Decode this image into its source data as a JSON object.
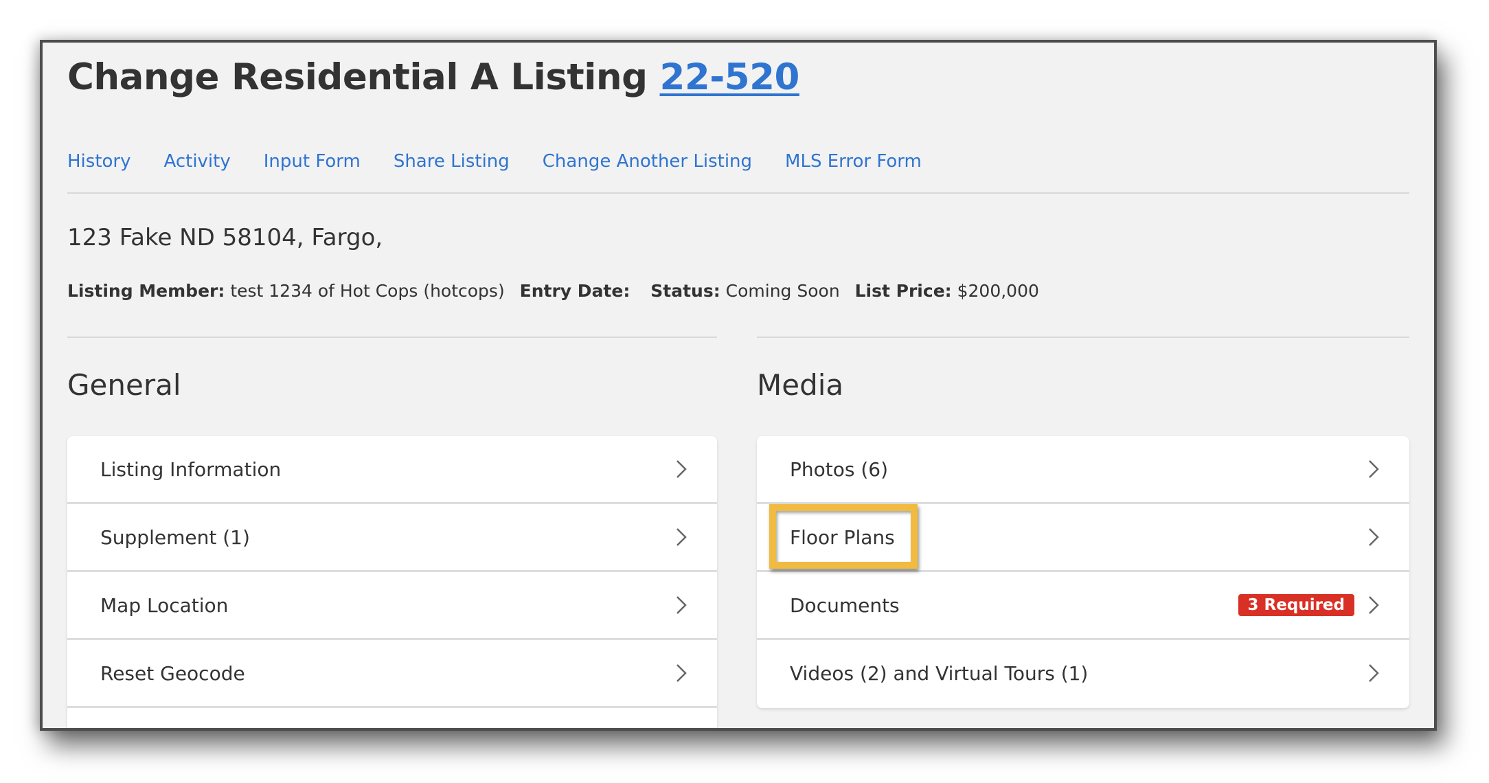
{
  "header": {
    "title": "Change Residential A Listing",
    "listing_id": "22-520"
  },
  "nav_links": [
    {
      "label": "History"
    },
    {
      "label": "Activity"
    },
    {
      "label": "Input Form"
    },
    {
      "label": "Share Listing"
    },
    {
      "label": "Change Another Listing"
    },
    {
      "label": "MLS Error Form"
    }
  ],
  "listing": {
    "address": "123 Fake ND 58104, Fargo,",
    "member_label": "Listing Member:",
    "member_value": "test 1234 of Hot Cops (hotcops)",
    "entry_date_label": "Entry Date:",
    "entry_date_value": "",
    "status_label": "Status:",
    "status_value": "Coming Soon",
    "price_label": "List Price:",
    "price_value": "$200,000"
  },
  "general": {
    "title": "General",
    "items": [
      {
        "label": "Listing Information"
      },
      {
        "label": "Supplement (1)"
      },
      {
        "label": "Map Location"
      },
      {
        "label": "Reset Geocode"
      },
      {
        "label": ""
      }
    ]
  },
  "media": {
    "title": "Media",
    "items": [
      {
        "label": "Photos (6)"
      },
      {
        "label": "Floor Plans",
        "highlighted": true
      },
      {
        "label": "Documents",
        "badge": "3 Required"
      },
      {
        "label": "Videos (2) and Virtual Tours (1)"
      }
    ]
  },
  "colors": {
    "link": "#2f74d0",
    "badge": "#d93025",
    "highlight": "#f0bb40",
    "background": "#f2f2f2"
  }
}
